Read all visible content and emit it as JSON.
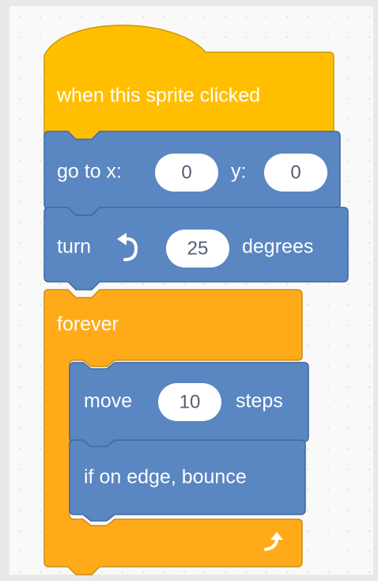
{
  "colors": {
    "events": "#ffbf00",
    "events_stroke": "#cc9900",
    "control": "#ffab19",
    "control_stroke": "#cf8b17",
    "motion": "#4c97ff",
    "motion_block": "#5a86c2",
    "motion_stroke": "#3d6aa0",
    "input_fill": "#ffffff",
    "input_text": "#575e75"
  },
  "script": {
    "hat": {
      "label": "when this sprite clicked"
    },
    "goto": {
      "label_x": "go to x:",
      "x_value": "0",
      "label_y": "y:",
      "y_value": "0"
    },
    "turn": {
      "label": "turn",
      "icon": "rotate-left-icon",
      "value": "25",
      "unit": "degrees"
    },
    "forever": {
      "label": "forever",
      "icon": "loop-arrow-icon"
    },
    "move": {
      "label": "move",
      "value": "10",
      "unit": "steps"
    },
    "bounce": {
      "label": "if on edge, bounce"
    }
  }
}
